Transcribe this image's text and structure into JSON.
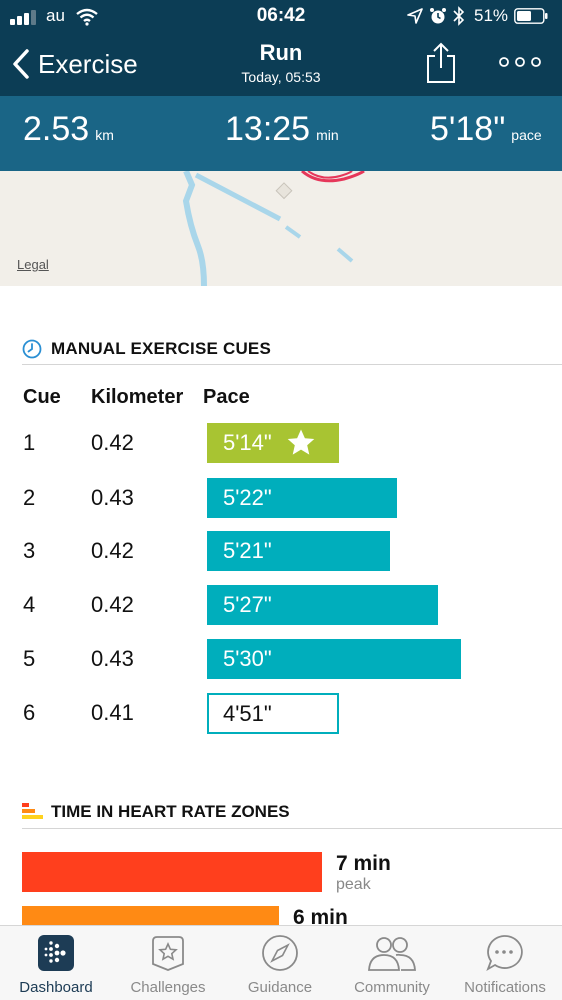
{
  "status": {
    "carrier": "au",
    "time": "06:42",
    "battery": "51%"
  },
  "nav": {
    "back_label": "Exercise",
    "title": "Run",
    "subtitle": "Today, 05:53",
    "share_icon": "share-icon",
    "more_icon": "more-icon"
  },
  "stats": {
    "distance": {
      "value": "2.53",
      "unit": "km"
    },
    "duration": {
      "value": "13:25",
      "unit": "min"
    },
    "pace": {
      "value": "5'18\"",
      "unit": "pace"
    }
  },
  "map": {
    "legal": "Legal"
  },
  "cues": {
    "title": "MANUAL EXERCISE CUES",
    "headers": {
      "cue": "Cue",
      "km": "Kilometer",
      "pace": "Pace"
    },
    "rows": [
      {
        "cue": "1",
        "km": "0.42",
        "pace": "5'14\"",
        "best": true
      },
      {
        "cue": "2",
        "km": "0.43",
        "pace": "5'22\""
      },
      {
        "cue": "3",
        "km": "0.42",
        "pace": "5'21\""
      },
      {
        "cue": "4",
        "km": "0.42",
        "pace": "5'27\""
      },
      {
        "cue": "5",
        "km": "0.43",
        "pace": "5'30\""
      },
      {
        "cue": "6",
        "km": "0.41",
        "pace": "4'51\"",
        "partial": true
      }
    ]
  },
  "hr_zones": {
    "title": "TIME IN HEART RATE ZONES",
    "zones": [
      {
        "value": "7 min",
        "label": "peak",
        "color": "#ff3f1d"
      },
      {
        "value": "6 min",
        "label": "",
        "color": "#ff8a14"
      }
    ]
  },
  "tabs": [
    {
      "label": "Dashboard",
      "icon": "dashboard-icon",
      "active": true
    },
    {
      "label": "Challenges",
      "icon": "challenges-star-icon"
    },
    {
      "label": "Guidance",
      "icon": "compass-icon"
    },
    {
      "label": "Community",
      "icon": "community-people-icon"
    },
    {
      "label": "Notifications",
      "icon": "notifications-chat-icon"
    }
  ],
  "colors": {
    "header_dark": "#0c3d55",
    "header_band": "#1a6586",
    "teal": "#00aebc",
    "lime": "#a8c432",
    "peak_red": "#ff3f1d",
    "cardio_orange": "#ff8a14"
  }
}
